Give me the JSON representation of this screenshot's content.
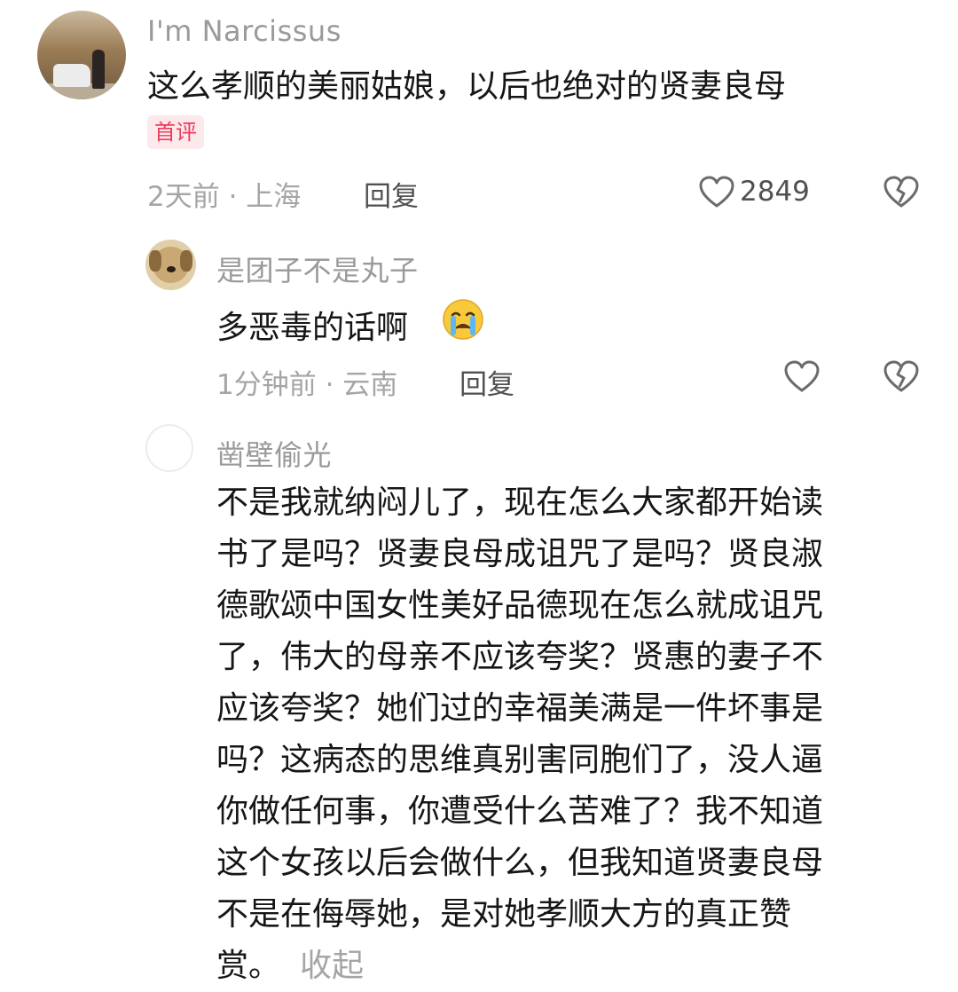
{
  "comment": {
    "username": "I'm Narcissus",
    "text": "这么孝顺的美丽姑娘，以后也绝对的贤妻良母",
    "badge": "首评",
    "meta": "2天前 · 上海",
    "reply_label": "回复",
    "like_count": "2849",
    "avatar_icon": "avatar-photo"
  },
  "replies": [
    {
      "username": "是团子不是丸子",
      "text": "多恶毒的话啊",
      "emoji": "loudly-crying-face",
      "meta": "1分钟前 · 云南",
      "reply_label": "回复",
      "avatar_icon": "dog-avatar"
    },
    {
      "username": "凿壁偷光",
      "lines": [
        "不是我就纳闷儿了，现在怎么大家都开始读",
        "书了是吗？贤妻良母成诅咒了是吗？贤良淑",
        "德歌颂中国女性美好品德现在怎么就成诅咒",
        "了，伟大的母亲不应该夸奖？贤惠的妻子不",
        "应该夸奖？她们过的幸福美满是一件坏事是",
        "吗？这病态的思维真别害同胞们了，没人逼",
        "你做任何事，你遭受什么苦难了？我不知道",
        "这个女孩以后会做什么，但我知道贤妻良母",
        "不是在侮辱她，是对她孝顺大方的真正赞",
        "赏。"
      ],
      "collapse_label": "收起",
      "avatar_icon": "empty-avatar"
    }
  ],
  "colors": {
    "text": "#161616",
    "muted": "#a5a5a5",
    "badge_bg": "#fbe9ec",
    "badge_text": "#ef3a5d"
  }
}
